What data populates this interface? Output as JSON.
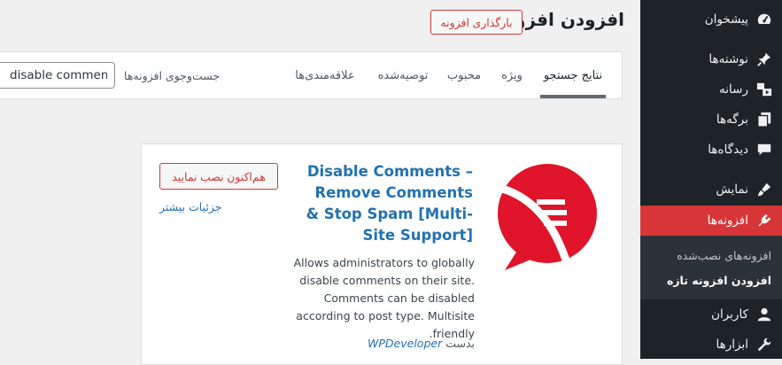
{
  "sidebar": {
    "items": [
      {
        "label": "پیشخوان",
        "icon": "dashboard-icon"
      },
      {
        "label": "نوشته‌ها",
        "icon": "pushpin-icon"
      },
      {
        "label": "رسانه",
        "icon": "media-icon"
      },
      {
        "label": "برگه‌ها",
        "icon": "pages-icon"
      },
      {
        "label": "دیدگاه‌ها",
        "icon": "comments-icon"
      },
      {
        "label": "نمایش",
        "icon": "paintbrush-icon"
      },
      {
        "label": "افزونه‌ها",
        "icon": "plugins-icon"
      },
      {
        "label": "کاربران",
        "icon": "users-icon"
      },
      {
        "label": "ابزارها",
        "icon": "tools-icon"
      }
    ],
    "submenu": [
      {
        "label": "افزونه‌های نصب‌شده"
      },
      {
        "label": "افزودن افزونه تازه"
      }
    ],
    "accent_color": "#d63638"
  },
  "header": {
    "title": "افزودن افزونه",
    "upload_button": "بارگذاری افزونه"
  },
  "filter": {
    "tabs": [
      {
        "label": "نتایج جستجو"
      },
      {
        "label": "ویژه"
      },
      {
        "label": "محبوب"
      },
      {
        "label": "توصیه‌شده"
      },
      {
        "label": "علاقه‌مندی‌ها"
      }
    ],
    "search_label": "جست‌وجوی افزونه‌ها",
    "search_value": "disable comments"
  },
  "plugin": {
    "name": "Disable Comments – Remove Comments & Stop Spam [Multi-Site Support]",
    "install_button": "هم‌اکنون نصب نمایید",
    "more_details": "جزئیات بیشتر",
    "description": "Allows administrators to globally disable comments on their site. Comments can be disabled according to post type. Multisite friendly.",
    "author_prefix": "بدست",
    "author": "WPDeveloper",
    "logo_icon": "disable-comments-logo-icon",
    "logo_color": "#e0142a"
  }
}
